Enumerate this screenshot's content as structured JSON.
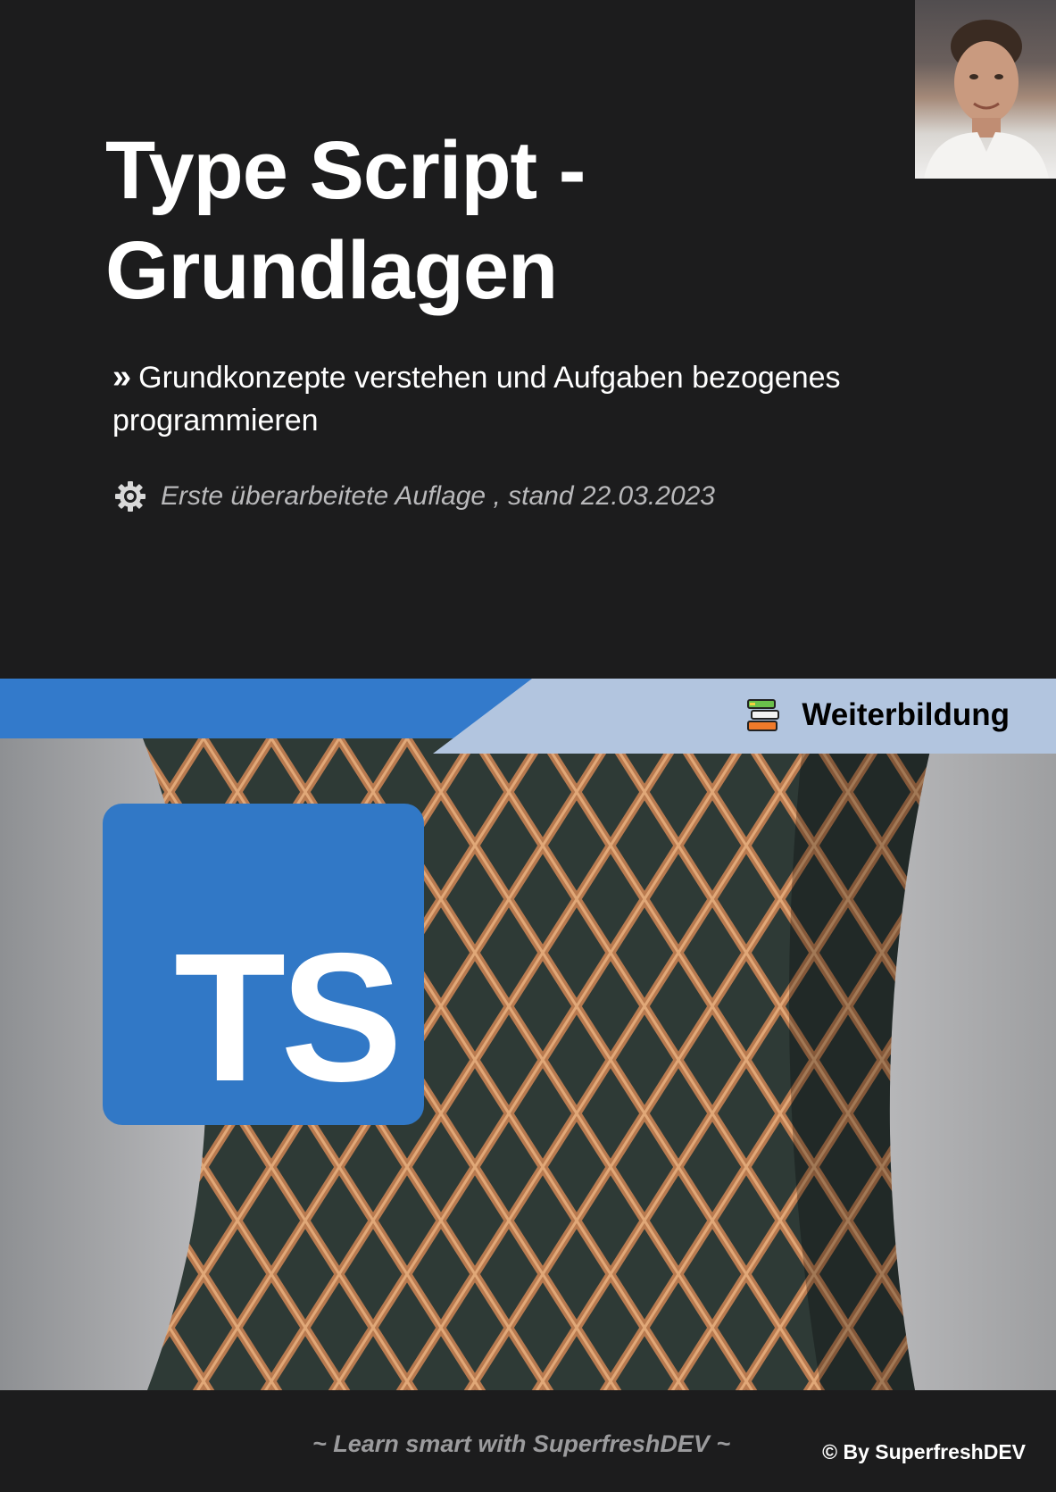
{
  "cover": {
    "title": "Type Script - Grundlagen",
    "subtitle_marker": "»",
    "subtitle": "Grundkonzepte verstehen und Aufgaben bezogenes programmieren",
    "edition_icon": "gear-icon",
    "edition": "Erste überarbeitete Auflage , stand 22.03.2023"
  },
  "banner": {
    "icon": "books-icon",
    "label": "Weiterbildung"
  },
  "logo": {
    "text": "TS",
    "color": "#3178c6"
  },
  "footer": {
    "tagline": "~ Learn smart with SuperfreshDEV ~",
    "copyright": "© By SuperfreshDEV"
  },
  "colors": {
    "background": "#1c1c1d",
    "banner_blue": "#337acb",
    "banner_light": "#b2c5df"
  }
}
